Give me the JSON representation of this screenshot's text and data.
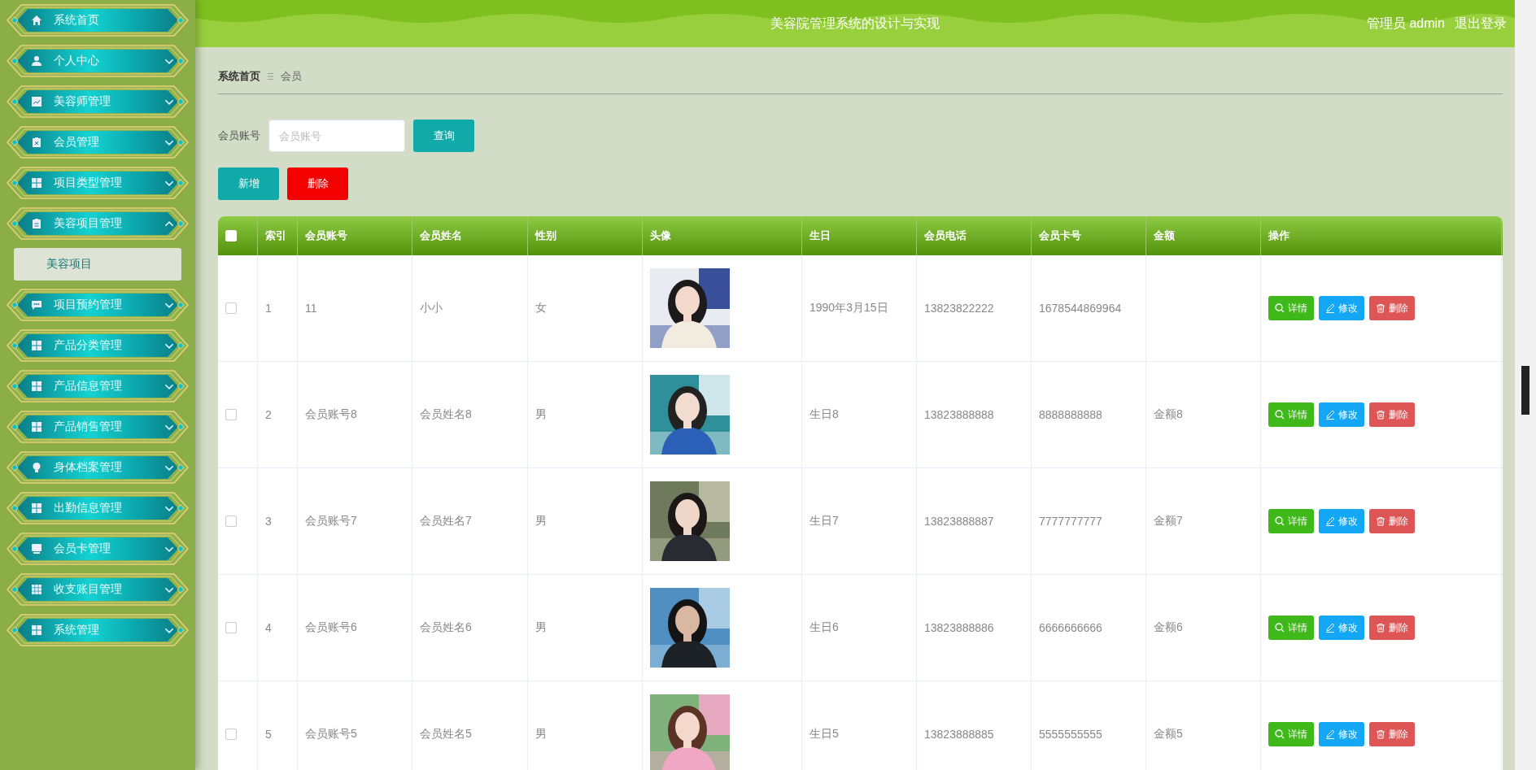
{
  "sidebar": {
    "items": [
      {
        "label": "系统首页",
        "kind": "link"
      },
      {
        "label": "个人中心",
        "kind": "menu",
        "expanded": false
      },
      {
        "label": "美容师管理",
        "kind": "menu",
        "expanded": false
      },
      {
        "label": "会员管理",
        "kind": "menu",
        "expanded": false
      },
      {
        "label": "项目类型管理",
        "kind": "menu",
        "expanded": false
      },
      {
        "label": "美容项目管理",
        "kind": "menu",
        "expanded": true,
        "children": [
          {
            "label": "美容项目",
            "selected": true
          }
        ]
      },
      {
        "label": "项目预约管理",
        "kind": "menu",
        "expanded": false
      },
      {
        "label": "产品分类管理",
        "kind": "menu",
        "expanded": false
      },
      {
        "label": "产品信息管理",
        "kind": "menu",
        "expanded": false
      },
      {
        "label": "产品销售管理",
        "kind": "menu",
        "expanded": false
      },
      {
        "label": "身体档案管理",
        "kind": "menu",
        "expanded": false
      },
      {
        "label": "出勤信息管理",
        "kind": "menu",
        "expanded": false
      },
      {
        "label": "会员卡管理",
        "kind": "menu",
        "expanded": false
      },
      {
        "label": "收支账目管理",
        "kind": "menu",
        "expanded": false
      },
      {
        "label": "系统管理",
        "kind": "menu",
        "expanded": false
      }
    ]
  },
  "header": {
    "title": "美容院管理系统的设计与实现",
    "user": "管理员 admin",
    "logout": "退出登录"
  },
  "breadcrumb": [
    "系统首页",
    "会员"
  ],
  "search": {
    "label": "会员账号",
    "placeholder": "会员账号",
    "button": "查询"
  },
  "toolbar": [
    {
      "label": "新增",
      "kind": "add"
    },
    {
      "label": "删除",
      "kind": "delete"
    }
  ],
  "table": {
    "select_all": {
      "checked": false
    },
    "columns": [
      "索引",
      "会员账号",
      "会员姓名",
      "性别",
      "头像",
      "生日",
      "会员电话",
      "会员卡号",
      "金额",
      "操作"
    ],
    "rows": [
      {
        "checked": false,
        "cells": [
          "1",
          "11",
          "小小",
          "女",
          {
            "kind": "picture"
          },
          "1990年3月15日",
          "13823822222",
          "1678544869964",
          ""
        ],
        "actions": [
          {
            "label": "详情",
            "kind": "detail"
          },
          {
            "label": "修改",
            "kind": "edit"
          },
          {
            "label": "删除",
            "kind": "delete"
          }
        ]
      },
      {
        "checked": false,
        "cells": [
          "2",
          "会员账号8",
          "会员姓名8",
          "男",
          {
            "kind": "picture"
          },
          "生日8",
          "13823888888",
          "8888888888",
          "金额8"
        ],
        "actions": [
          {
            "label": "详情",
            "kind": "detail"
          },
          {
            "label": "修改",
            "kind": "edit"
          },
          {
            "label": "删除",
            "kind": "delete"
          }
        ]
      },
      {
        "checked": false,
        "cells": [
          "3",
          "会员账号7",
          "会员姓名7",
          "男",
          {
            "kind": "picture"
          },
          "生日7",
          "13823888887",
          "7777777777",
          "金额7"
        ],
        "actions": [
          {
            "label": "详情",
            "kind": "detail"
          },
          {
            "label": "修改",
            "kind": "edit"
          },
          {
            "label": "删除",
            "kind": "delete"
          }
        ]
      },
      {
        "checked": false,
        "cells": [
          "4",
          "会员账号6",
          "会员姓名6",
          "男",
          {
            "kind": "picture"
          },
          "生日6",
          "13823888886",
          "6666666666",
          "金额6"
        ],
        "actions": [
          {
            "label": "详情",
            "kind": "detail"
          },
          {
            "label": "修改",
            "kind": "edit"
          },
          {
            "label": "删除",
            "kind": "delete"
          }
        ]
      },
      {
        "checked": false,
        "cells": [
          "5",
          "会员账号5",
          "会员姓名5",
          "男",
          {
            "kind": "picture"
          },
          "生日5",
          "13823888885",
          "5555555555",
          "金额5"
        ],
        "actions": [
          {
            "label": "详情",
            "kind": "detail"
          },
          {
            "label": "修改",
            "kind": "edit"
          },
          {
            "label": "删除",
            "kind": "delete"
          }
        ]
      }
    ]
  }
}
